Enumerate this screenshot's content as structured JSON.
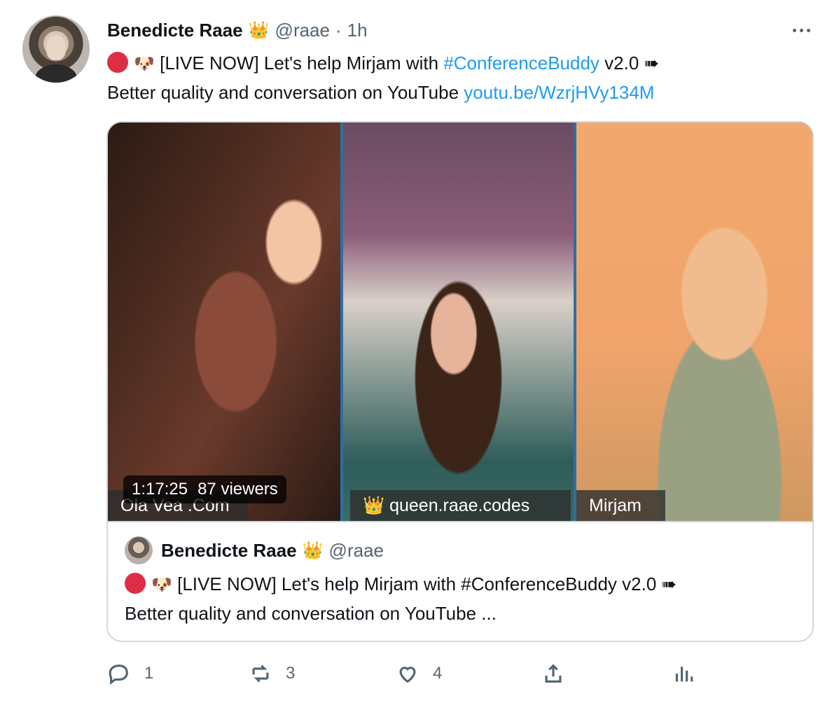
{
  "tweet": {
    "name": "Benedicte Raae",
    "crown_emoji": "👑",
    "handle": "@raae",
    "dot": "·",
    "time": "1h",
    "red_icon": "red-circle-icon",
    "dog_emoji": "🐶",
    "text_before_link": "[LIVE NOW] Let's help Mirjam with ",
    "hashtag": "#ConferenceBuddy",
    "text_after_hashtag": " v2.0 ➠",
    "text_line2": "Better quality and conversation on YouTube ",
    "url": "youtu.be/WzrjHVy134M"
  },
  "video": {
    "time": "1:17:25",
    "viewers": "87 viewers",
    "labels": [
      "Ola Vea .Com",
      "👑 queen.raae.codes",
      "Mirjam"
    ]
  },
  "quote": {
    "name": "Benedicte Raae",
    "crown_emoji": "👑",
    "handle": "@raae",
    "dog_emoji": "🐶",
    "line1": "[LIVE NOW] Let's help Mirjam with #ConferenceBuddy v2.0 ➠",
    "line2": "Better quality and conversation on YouTube ..."
  },
  "actions": {
    "reply_count": "1",
    "retweet_count": "3",
    "like_count": "4",
    "reply_icon": "reply-icon",
    "retweet_icon": "retweet-icon",
    "like_icon": "heart-icon",
    "share_icon": "share-icon",
    "analytics_icon": "analytics-icon"
  },
  "colors": {
    "link": "#1d9bf0",
    "muted": "#536471",
    "red_circle": "#dd2e44"
  }
}
